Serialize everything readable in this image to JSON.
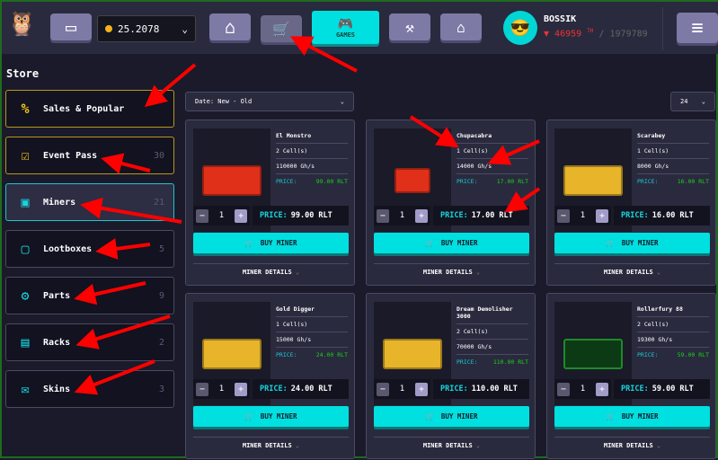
{
  "header": {
    "balance": "25.2078",
    "games_label": "GAMES",
    "username": "BOSSIK",
    "power": "46959",
    "power_unit": "TH",
    "power_total": "/ 1979789"
  },
  "sidebar": {
    "title": "Store",
    "items": [
      {
        "label": "Sales & Popular",
        "count": "",
        "icon": "percent-badge-icon",
        "style": "gold"
      },
      {
        "label": "Event Pass",
        "count": "30",
        "icon": "calendar-check-icon",
        "style": "gold"
      },
      {
        "label": "Miners",
        "count": "21",
        "icon": "miner-icon",
        "style": "act"
      },
      {
        "label": "Lootboxes",
        "count": "5",
        "icon": "lootbox-icon",
        "style": ""
      },
      {
        "label": "Parts",
        "count": "9",
        "icon": "screw-nut-icon",
        "style": ""
      },
      {
        "label": "Racks",
        "count": "2",
        "icon": "rack-icon",
        "style": ""
      },
      {
        "label": "Skins",
        "count": "3",
        "icon": "image-icon",
        "style": ""
      }
    ]
  },
  "sort": {
    "selected": "Date: New - Old"
  },
  "per_page": {
    "selected": "24"
  },
  "labels": {
    "price": "PRICE:",
    "total_price": "PRICE:",
    "buy": "BUY MINER",
    "details": "MINER DETAILS"
  },
  "miners": [
    {
      "name": "El Monstro",
      "cells": "2 Cell(s)",
      "power": "110000 Gh/s",
      "price": "99.00 RLT",
      "qty": "1",
      "color": "#e0301a"
    },
    {
      "name": "Chupacabra",
      "cells": "1 Cell(s)",
      "power": "14000 Gh/s",
      "price": "17.00 RLT",
      "qty": "1",
      "color": "#e0301a"
    },
    {
      "name": "Scarabey",
      "cells": "1 Cell(s)",
      "power": "8000 Gh/s",
      "price": "16.00 RLT",
      "qty": "1",
      "color": "#e8b52a"
    },
    {
      "name": "Gold Digger",
      "cells": "1 Cell(s)",
      "power": "15000 Gh/s",
      "price": "24.00 RLT",
      "qty": "1",
      "color": "#e8b52a"
    },
    {
      "name": "Dream Demolisher 3000",
      "cells": "2 Cell(s)",
      "power": "70000 Gh/s",
      "price": "110.00 RLT",
      "qty": "1",
      "color": "#e8b52a"
    },
    {
      "name": "Rollerfury 88",
      "cells": "2 Cell(s)",
      "power": "19300 Gh/s",
      "price": "59.00 RLT",
      "qty": "1",
      "color": "#0c3a14"
    }
  ]
}
